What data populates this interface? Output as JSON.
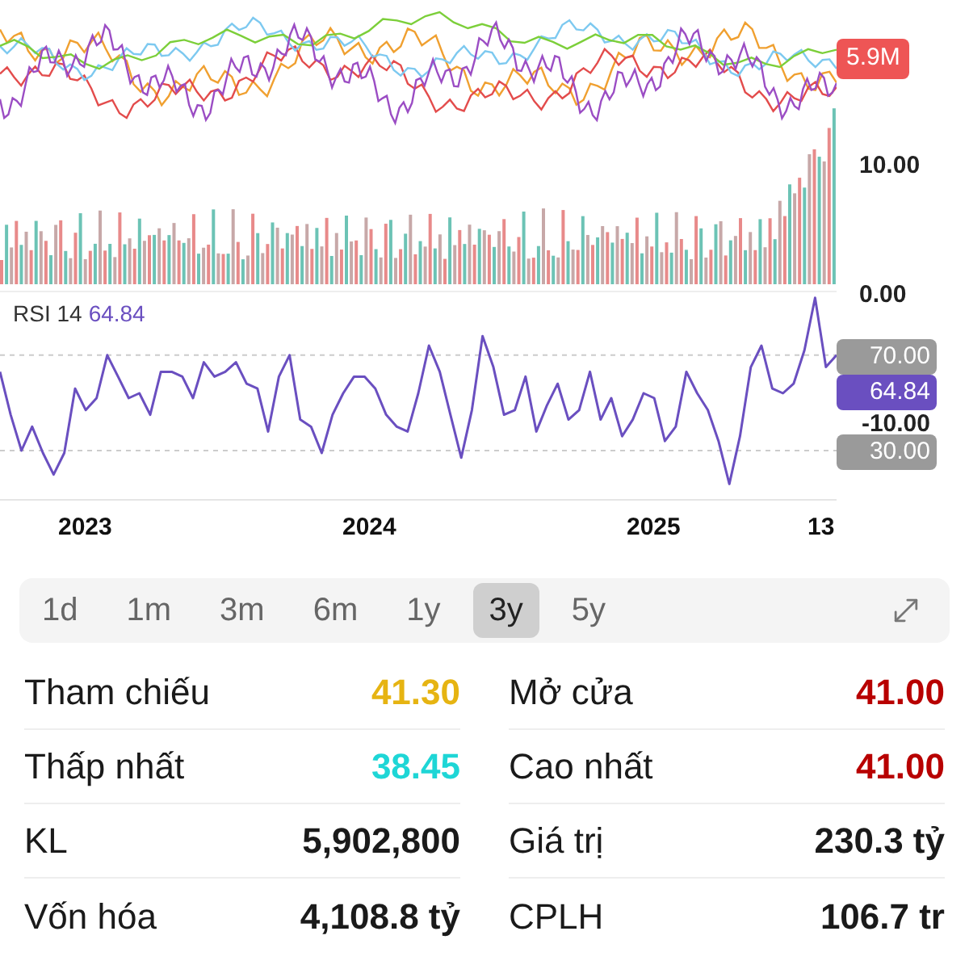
{
  "price_chart": {
    "axis_labels": [
      "10.00",
      "0.00"
    ],
    "volume_badge": "5.9M"
  },
  "rsi": {
    "value": "64.84",
    "badges": [
      {
        "text": "64.84",
        "kind": "current"
      },
      {
        "text": "-10.00",
        "kind": "axis"
      }
    ],
    "chart_data": {
      "type": "line",
      "ylim": [
        9,
        97
      ],
      "yticks": [
        {
          "value": 70,
          "label": "70.00"
        },
        {
          "value": 30,
          "label": "30.00"
        }
      ],
      "series": [
        {
          "name": "RSI 14",
          "color": "#6a4fc0",
          "values": [
            63,
            45,
            30,
            40,
            29,
            20,
            29,
            56,
            47,
            52,
            70,
            61,
            52,
            54,
            45,
            63,
            63,
            61,
            52,
            67,
            61,
            63,
            67,
            58,
            56,
            38,
            61,
            70,
            43,
            40,
            29,
            45,
            54,
            61,
            61,
            56,
            45,
            40,
            38,
            54,
            74,
            63,
            45,
            27,
            47,
            78,
            65,
            45,
            47,
            61,
            38,
            49,
            58,
            43,
            47,
            63,
            43,
            52,
            36,
            43,
            54,
            52,
            34,
            40,
            63,
            54,
            47,
            34,
            16,
            36,
            65,
            74,
            56,
            54,
            58,
            72,
            94,
            65,
            70
          ]
        }
      ]
    }
  },
  "x_axis": [
    "2023",
    "2024",
    "2025",
    "13"
  ],
  "ranges": [
    {
      "label": "1d",
      "selected": false
    },
    {
      "label": "1m",
      "selected": false
    },
    {
      "label": "3m",
      "selected": false
    },
    {
      "label": "6m",
      "selected": false
    },
    {
      "label": "1y",
      "selected": false
    },
    {
      "label": "3y",
      "selected": true
    },
    {
      "label": "5y",
      "selected": false
    }
  ],
  "stats": [
    {
      "label": "Tham chiếu",
      "value": "41.30",
      "color": "#e6b412"
    },
    {
      "label": "Mở cửa",
      "value": "41.00",
      "color": "#b80000"
    },
    {
      "label": "Thấp nhất",
      "value": "38.45",
      "color": "#1ed6d6"
    },
    {
      "label": "Cao nhất",
      "value": "41.00",
      "color": "#b80000"
    },
    {
      "label": "KL",
      "value": "5,902,800",
      "color": "#1a1a1a"
    },
    {
      "label": "Giá trị",
      "value": "230.3 tỷ",
      "color": "#1a1a1a"
    },
    {
      "label": "Vốn hóa",
      "value": "4,108.8 tỷ",
      "color": "#1a1a1a"
    },
    {
      "label": "CPLH",
      "value": "106.7 tr",
      "color": "#1a1a1a"
    }
  ]
}
